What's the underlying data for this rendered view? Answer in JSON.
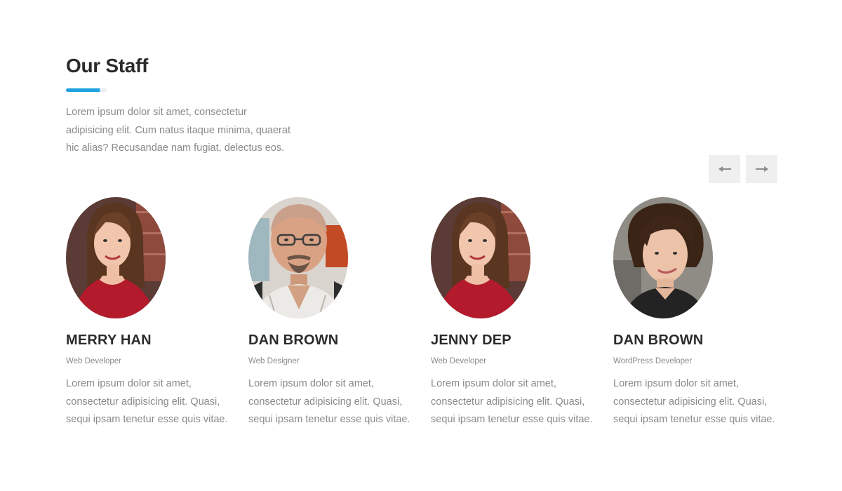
{
  "section": {
    "title": "Our Staff",
    "intro": "Lorem ipsum dolor sit amet, consectetur adipisicing elit. Cum natus itaque minima, quaerat hic alias? Recusandae nam fugiat, delectus eos.",
    "accent_color": "#1ea3e0"
  },
  "nav": {
    "prev_icon": "arrow-left-icon",
    "next_icon": "arrow-right-icon"
  },
  "members": [
    {
      "name": "MERRY HAN",
      "role": "Web Developer",
      "bio": "Lorem ipsum dolor sit amet, consectetur adipisicing elit. Quasi, sequi ipsam tenetur esse quis vitae."
    },
    {
      "name": "DAN BROWN",
      "role": "Web Designer",
      "bio": "Lorem ipsum dolor sit amet, consectetur adipisicing elit. Quasi, sequi ipsam tenetur esse quis vitae."
    },
    {
      "name": "JENNY DEP",
      "role": "Web Developer",
      "bio": "Lorem ipsum dolor sit amet, consectetur adipisicing elit. Quasi, sequi ipsam tenetur esse quis vitae."
    },
    {
      "name": "DAN BROWN",
      "role": "WordPress Developer",
      "bio": "Lorem ipsum dolor sit amet, consectetur adipisicing elit. Quasi, sequi ipsam tenetur esse quis vitae."
    }
  ]
}
